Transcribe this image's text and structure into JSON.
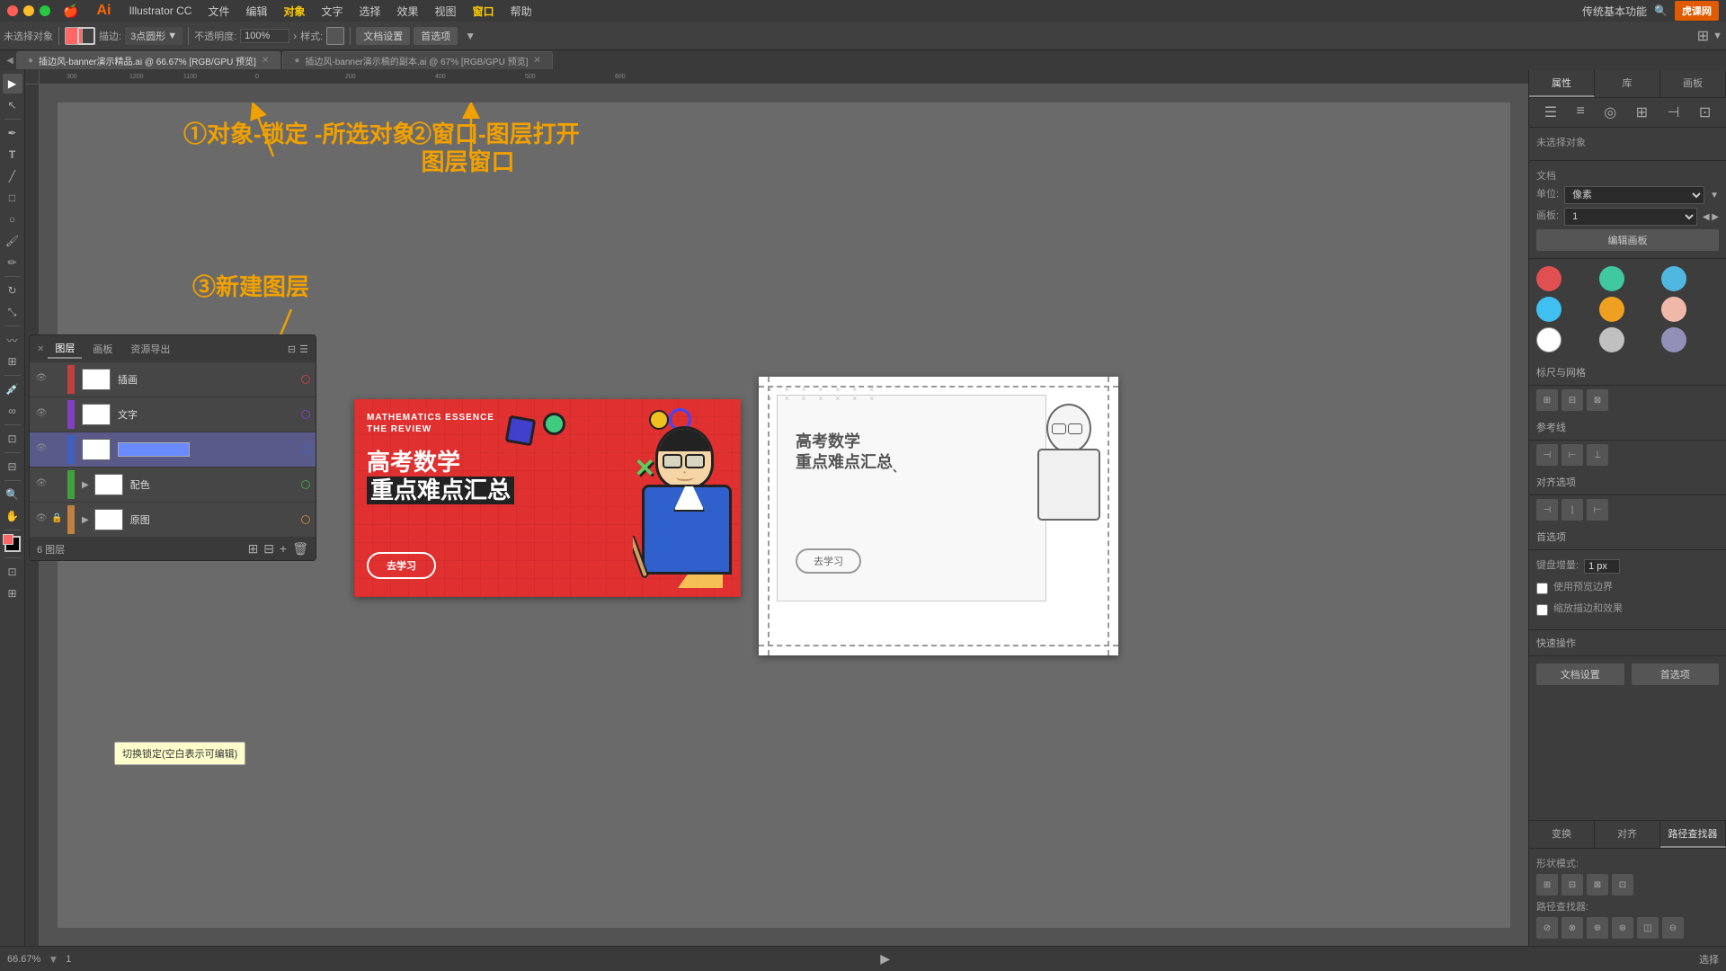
{
  "menubar": {
    "apple": "🍎",
    "app_name": "Illustrator CC",
    "menus": [
      "文件",
      "编辑",
      "对象",
      "文字",
      "选择",
      "效果",
      "视图",
      "窗口",
      "帮助"
    ],
    "ai_logo": "Ai",
    "right_label": "传统基本功能"
  },
  "toolbar": {
    "no_selection": "未选择对象",
    "stroke_label": "描边:",
    "stroke_value": "3点圆形",
    "opacity_label": "不透明度:",
    "opacity_value": "100%",
    "style_label": "样式:",
    "doc_settings": "文档设置",
    "preferences": "首选项"
  },
  "tabs": [
    {
      "label": "插边风-banner演示精品.ai @ 66.67% [RGB/GPU 预览]",
      "active": true
    },
    {
      "label": "插边风-banner演示稿的副本.ai @ 67% [RGB/GPU 预览]",
      "active": false
    }
  ],
  "annotations": {
    "ann1": "①对象-锁定\n  -所选对象",
    "ann2": "②窗口-图层打开\n  图层窗口",
    "ann3": "③新建图层"
  },
  "right_panel": {
    "tabs": [
      "属性",
      "库",
      "画板"
    ],
    "selection_label": "未选择对象",
    "doc_section": "文档",
    "unit_label": "单位:",
    "unit_value": "像素",
    "template_label": "画板:",
    "template_value": "1",
    "edit_template_btn": "编辑画板",
    "ruler_grid_label": "标尺与网格",
    "guides_label": "参考线",
    "align_label": "对齐选项",
    "preferences_label": "首选项",
    "keyboard_increment_label": "键盘增量:",
    "keyboard_increment_value": "1 px",
    "use_preview_bounds": "使用预览边界",
    "scale_corners": "缩放描边和效果",
    "quick_actions_label": "快速操作",
    "doc_settings_btn": "文档设置",
    "pref_btn": "首选项",
    "colors": [
      {
        "color": "#e05050",
        "name": "red"
      },
      {
        "color": "#40c8a0",
        "name": "teal"
      },
      {
        "color": "#50b8e0",
        "name": "blue"
      },
      {
        "color": "#40c0f0",
        "name": "light-blue"
      },
      {
        "color": "#f0a020",
        "name": "orange"
      },
      {
        "color": "#f0b8a8",
        "name": "pink"
      },
      {
        "color": "#ffffff",
        "name": "white"
      },
      {
        "color": "#c0c0c0",
        "name": "gray"
      },
      {
        "color": "#9090b8",
        "name": "lavender"
      }
    ],
    "bottom_tabs": [
      "变换",
      "对齐",
      "路径查找器"
    ],
    "shape_mode_label": "形状模式:",
    "pathfinder_label": "路径查找器:"
  },
  "layers_panel": {
    "tabs": [
      "图层",
      "画板",
      "资源导出"
    ],
    "layers": [
      {
        "name": "插画",
        "visible": true,
        "locked": false,
        "color": "#c04040",
        "has_children": false,
        "circle_color": "#c04040"
      },
      {
        "name": "文字",
        "visible": true,
        "locked": false,
        "color": "#8040c0",
        "has_children": false,
        "circle_color": "#8040c0"
      },
      {
        "name": "",
        "visible": true,
        "locked": false,
        "color": "#4060c0",
        "has_children": false,
        "is_editing": true,
        "circle_color": "#4060c0"
      },
      {
        "name": "配色",
        "visible": true,
        "locked": false,
        "color": "#40a040",
        "has_children": true,
        "circle_color": "#40a040"
      },
      {
        "name": "原图",
        "visible": true,
        "locked": true,
        "color": "#c08040",
        "has_children": true,
        "circle_color": "#c08040"
      }
    ],
    "layer_count": "6 图层",
    "tooltip": "切换锁定(空白表示可编辑)"
  },
  "statusbar": {
    "zoom": "66.67%",
    "artboard": "1",
    "selection": "选择"
  },
  "logo": {
    "text": "虎课网"
  }
}
